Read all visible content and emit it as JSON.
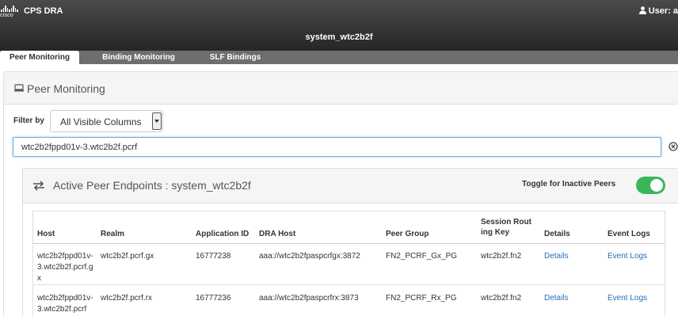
{
  "header": {
    "brand": "cisco",
    "app_title": "CPS DRA",
    "user_label": "User: a",
    "system_title": "system_wtc2b2f"
  },
  "tabs": [
    {
      "label": "Peer Monitoring",
      "active": true
    },
    {
      "label": "Binding Monitoring",
      "active": false
    },
    {
      "label": "SLF Bindings",
      "active": false
    }
  ],
  "panel": {
    "title": "Peer Monitoring",
    "filter_label": "Filter by",
    "filter_select": "All Visible Columns",
    "search_value": "wtc2b2fppd01v-3.wtc2b2f.pcrf"
  },
  "endpoints": {
    "title": "Active Peer Endpoints : system_wtc2b2f",
    "toggle_label": "Toggle for Inactive Peers",
    "toggle_on": true,
    "toggle_color": "#3cb65a",
    "columns": [
      "Host",
      "Realm",
      "Application ID",
      "DRA Host",
      "Peer Group",
      "Session Rout ing Key",
      "Details",
      "Event Logs"
    ],
    "rows": [
      {
        "host": "wtc2b2fppd01v-3.wtc2b2f.pcrf.gx",
        "realm": "wtc2b2f.pcrf.gx",
        "app_id": "16777238",
        "dra_host": "aaa://wtc2b2fpaspcrfgx:3872",
        "peer_group": "FN2_PCRF_Gx_PG",
        "srk": "wtc2b2f.fn2",
        "details": "Details",
        "event_logs": "Event Logs"
      },
      {
        "host": "wtc2b2fppd01v-3.wtc2b2f.pcrf",
        "realm": "wtc2b2f.pcrf.rx",
        "app_id": "16777236",
        "dra_host": "aaa://wtc2b2fpaspcrfrx:3873",
        "peer_group": "FN2_PCRF_Rx_PG",
        "srk": "wtc2b2f.fn2",
        "details": "Details",
        "event_logs": "Event Logs"
      }
    ]
  },
  "icons": [
    "cisco-logo-icon",
    "user-icon",
    "monitor-icon",
    "dropdown-caret-icon",
    "clear-icon",
    "swap-arrows-icon"
  ]
}
